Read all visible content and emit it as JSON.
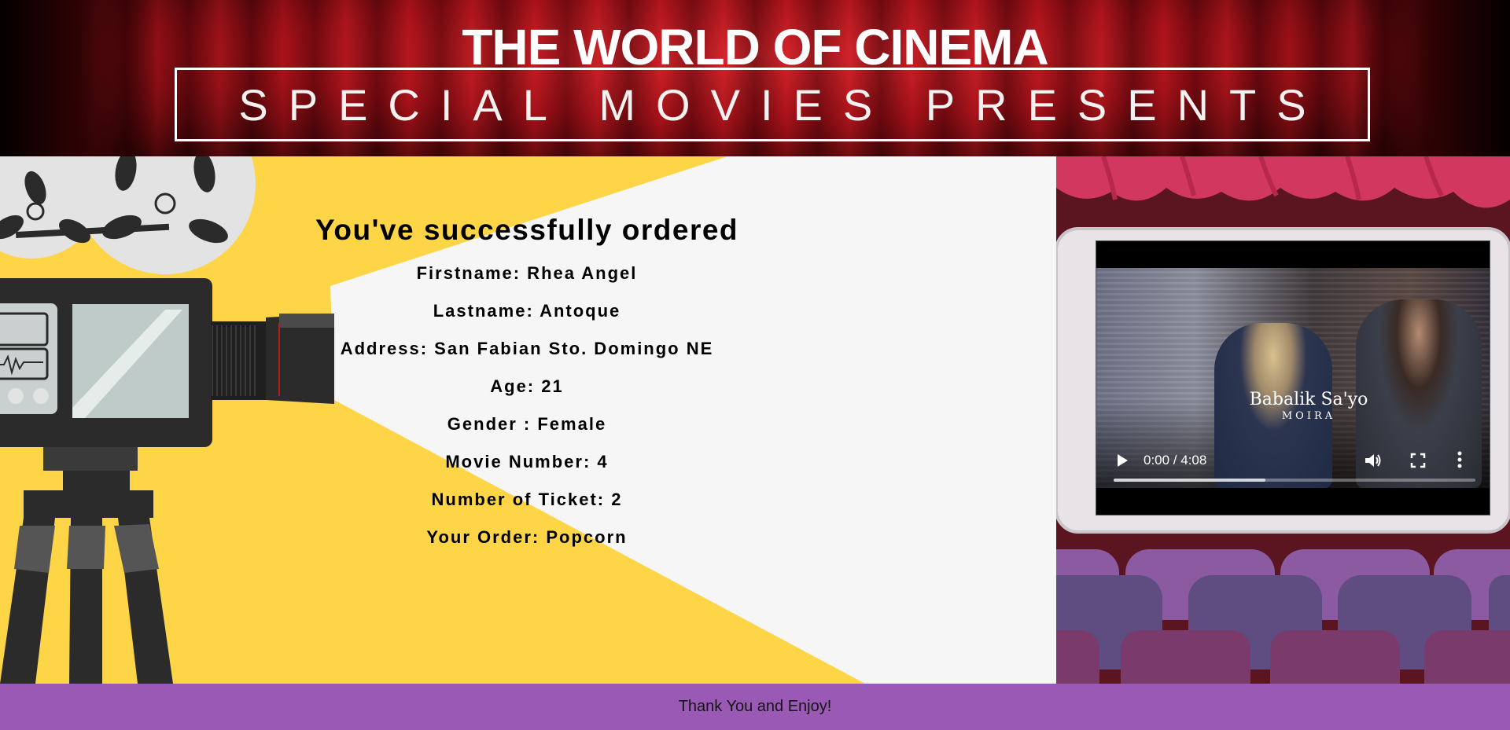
{
  "header": {
    "title": "THE WORLD OF CINEMA",
    "subtitle": "SPECIAL MOVIES PRESENTS"
  },
  "order": {
    "heading": "You've successfully ordered",
    "lines": [
      "Firstname: Rhea Angel",
      "Lastname: Antoque",
      "Address: San Fabian Sto. Domingo NE",
      "Age: 21",
      "Gender : Female",
      "Movie Number: 4",
      "Number of Ticket: 2",
      "Your Order: Popcorn"
    ]
  },
  "video": {
    "song_title": "Babalik Sa'yo",
    "artist": "MOIRA",
    "time": "0:00 / 4:08",
    "buffered_fraction": 0.42,
    "icons": [
      "play-icon",
      "volume-icon",
      "fullscreen-icon",
      "more-options-icon"
    ]
  },
  "footer": {
    "text": "Thank You and Enjoy!"
  },
  "colors": {
    "accent_yellow": "#fed547",
    "footer_purple": "#9a59b5",
    "curtain_red": "#b3121b"
  }
}
